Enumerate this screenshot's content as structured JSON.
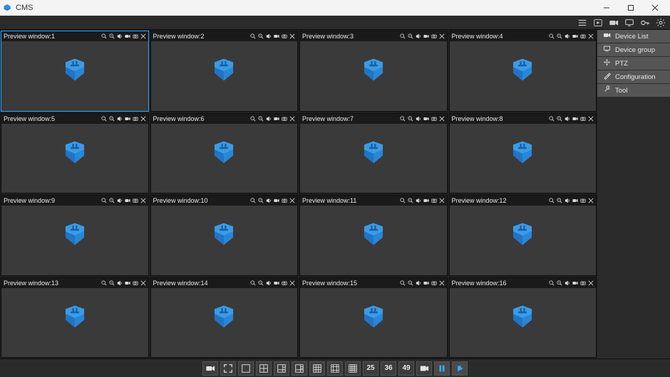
{
  "app": {
    "title": "CMS"
  },
  "windows": [
    {
      "label": "Preview window:1",
      "selected": true
    },
    {
      "label": "Preview window:2"
    },
    {
      "label": "Preview window:3"
    },
    {
      "label": "Preview window:4"
    },
    {
      "label": "Preview window:5"
    },
    {
      "label": "Preview window:6"
    },
    {
      "label": "Preview window:7"
    },
    {
      "label": "Preview window:8"
    },
    {
      "label": "Preview window:9"
    },
    {
      "label": "Preview window:10"
    },
    {
      "label": "Preview window:11"
    },
    {
      "label": "Preview window:12"
    },
    {
      "label": "Preview window:13"
    },
    {
      "label": "Preview window:14"
    },
    {
      "label": "Preview window:15"
    },
    {
      "label": "Preview window:16"
    }
  ],
  "sidepanel": {
    "items": [
      {
        "label": "Device List",
        "icon": "camera"
      },
      {
        "label": "Device group",
        "icon": "folder"
      },
      {
        "label": "PTZ",
        "icon": "ptz"
      },
      {
        "label": "Configuration",
        "icon": "config"
      },
      {
        "label": "Tool",
        "icon": "tool"
      }
    ]
  },
  "bottombar": {
    "numeric": [
      "25",
      "36",
      "49"
    ]
  }
}
